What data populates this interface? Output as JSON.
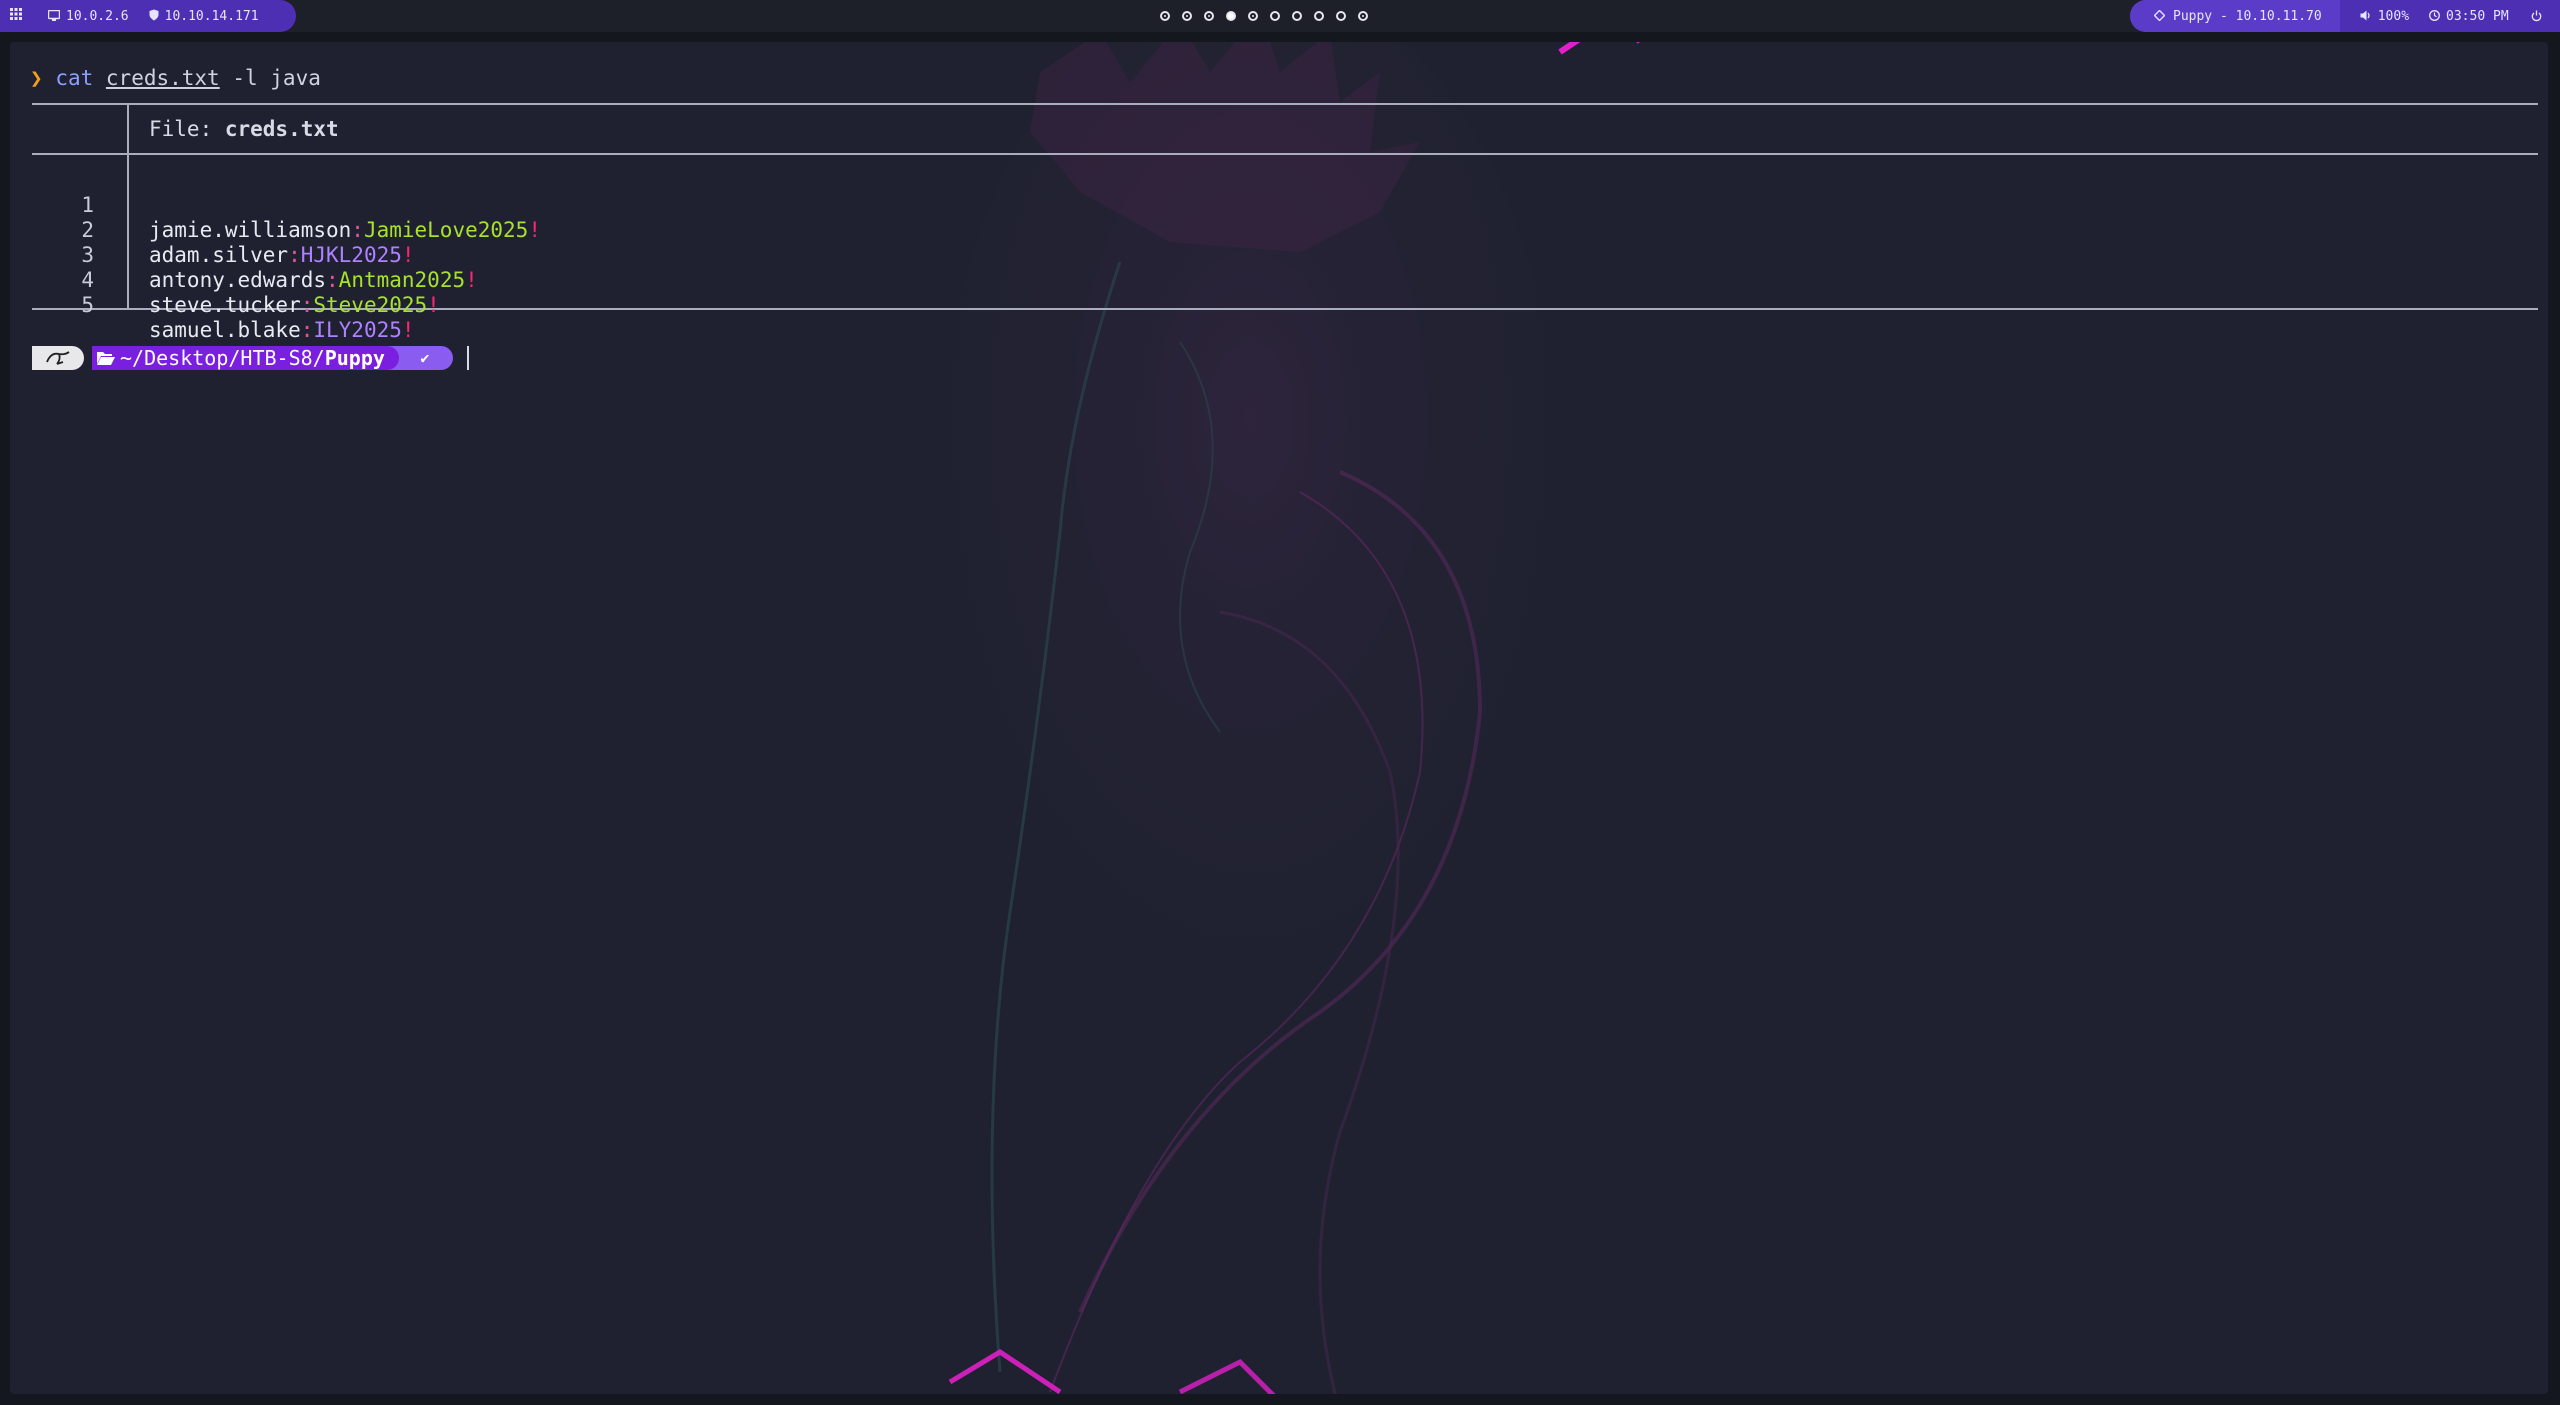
{
  "topbar": {
    "menu_icon": "grid-icon",
    "host_ip": "10.0.2.6",
    "vpn_ip": "10.10.14.171",
    "workspaces": [
      {
        "state": "used"
      },
      {
        "state": "used"
      },
      {
        "state": "used"
      },
      {
        "state": "active"
      },
      {
        "state": "used"
      },
      {
        "state": "empty"
      },
      {
        "state": "empty"
      },
      {
        "state": "empty"
      },
      {
        "state": "empty"
      },
      {
        "state": "used"
      }
    ],
    "target": "Puppy - 10.10.11.70",
    "volume": "100%",
    "clock": "03:50 PM"
  },
  "terminal": {
    "prompt_symbol": "❯",
    "command": "cat",
    "argument": "creds.txt",
    "flags": "-l java",
    "file_header_prefix": "File: ",
    "file_name": "creds.txt",
    "lines": [
      {
        "num": "1",
        "user": "jamie.williamson",
        "sep": ":",
        "password": "JamieLove2025",
        "bang": "!",
        "pw_color": "green"
      },
      {
        "num": "2",
        "user": "adam.silver",
        "sep": ":",
        "password": "HJKL2025",
        "bang": "!",
        "pw_color": "purple"
      },
      {
        "num": "3",
        "user": "antony.edwards",
        "sep": ":",
        "password": "Antman2025",
        "bang": "!",
        "pw_color": "green"
      },
      {
        "num": "4",
        "user": "steve.tucker",
        "sep": ":",
        "password": "Steve2025",
        "bang": "!",
        "pw_color": "green"
      },
      {
        "num": "5",
        "user": "samuel.blake",
        "sep": ":",
        "password": "ILY2025",
        "bang": "!",
        "pw_color": "purple"
      }
    ],
    "prompt": {
      "os_icon": "kali-dragon-icon",
      "dir_icon": "folder-open-icon",
      "path_prefix": "~/Desktop/HTB-S8/",
      "path_current": "Puppy",
      "status": "✔"
    }
  },
  "colors": {
    "accent_purple": "#4d2fb4",
    "prompt_dir": "#7a1fe0",
    "password_green": "#a6e22e",
    "password_purple": "#ae81ff",
    "bang_red": "#f92672"
  }
}
